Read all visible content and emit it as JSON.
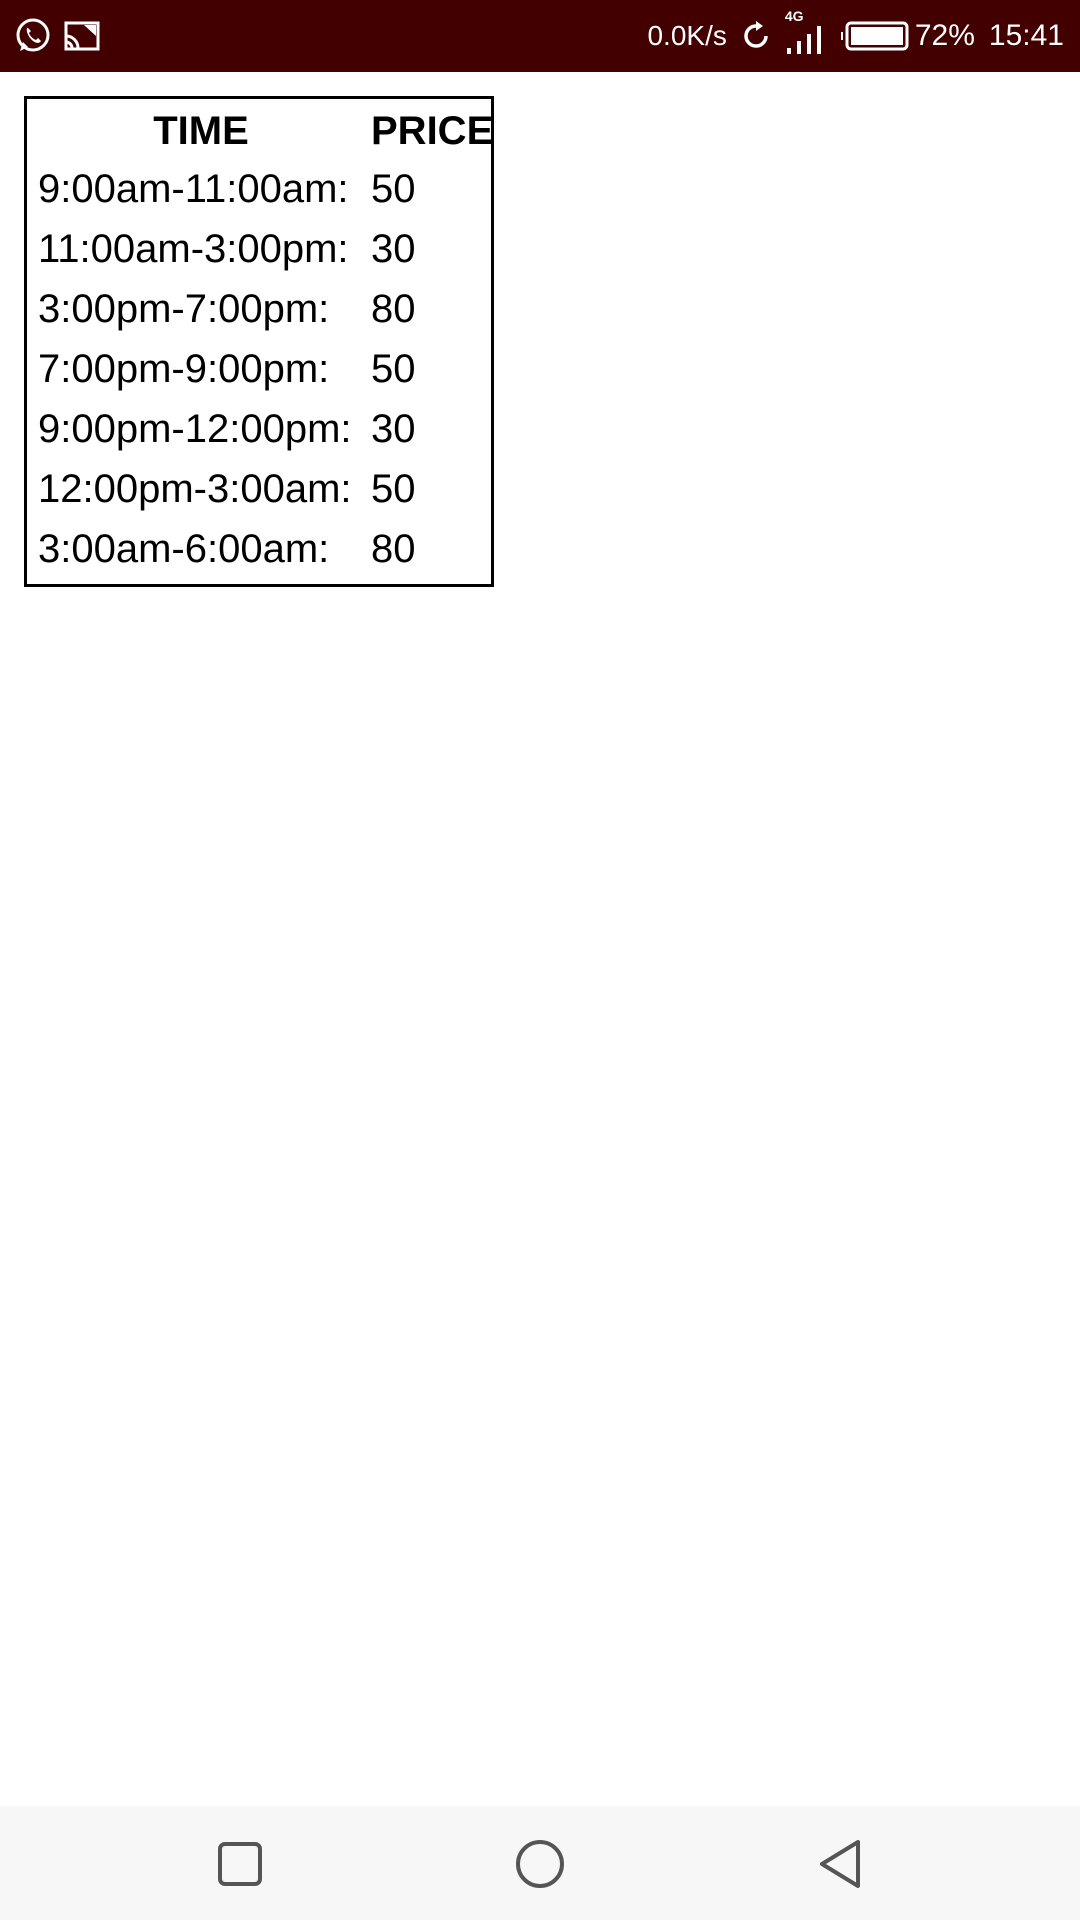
{
  "status_bar": {
    "left_icons": [
      "whatsapp-icon",
      "cast-screen-icon"
    ],
    "net_speed": "0.0K/s",
    "network_type": "4G",
    "battery_percent": "72%",
    "battery_level": 0.72,
    "time": "15:41",
    "background_color": "#420000"
  },
  "price_table": {
    "headers": {
      "time": "TIME",
      "price": "PRICE"
    },
    "rows": [
      {
        "time": "9:00am-11:00am:",
        "price": "50"
      },
      {
        "time": "11:00am-3:00pm:",
        "price": "30"
      },
      {
        "time": "3:00pm-7:00pm:",
        "price": "80"
      },
      {
        "time": "7:00pm-9:00pm:",
        "price": "50"
      },
      {
        "time": "9:00pm-12:00pm:",
        "price": "30"
      },
      {
        "time": "12:00pm-3:00am:",
        "price": "50"
      },
      {
        "time": "3:00am-6:00am:",
        "price": "80"
      }
    ]
  },
  "nav_bar": {
    "buttons": [
      "recent-apps-icon",
      "home-icon",
      "back-icon"
    ]
  }
}
